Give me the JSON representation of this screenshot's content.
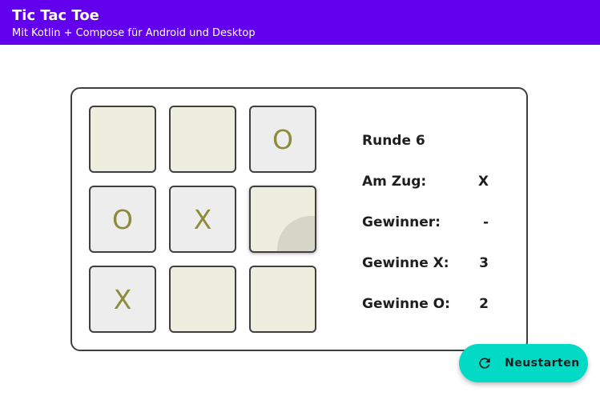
{
  "app": {
    "title": "Tic Tac Toe",
    "subtitle": "Mit Kotlin + Compose für Android und Desktop"
  },
  "board": {
    "cells": [
      "",
      "",
      "O",
      "O",
      "X",
      "",
      "X",
      "",
      ""
    ]
  },
  "status": {
    "round": "Runde 6",
    "turn_label": "Am Zug:",
    "turn_value": "X",
    "winner_label": "Gewinner:",
    "winner_value": "-",
    "wins_x_label": "Gewinne X:",
    "wins_x_value": "3",
    "wins_o_label": "Gewinne O:",
    "wins_o_value": "2"
  },
  "actions": {
    "restart_label": "Neustarten",
    "restart_icon": "refresh-icon"
  },
  "colors": {
    "primary": "#6200EE",
    "secondary": "#03DAC5",
    "cell_empty": "#EEEEDF",
    "cell_filled": "#EDEDED",
    "mark": "#8C8C3C"
  }
}
